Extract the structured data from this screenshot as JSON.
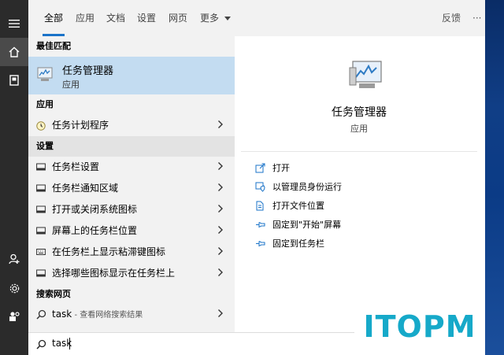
{
  "rail": {
    "icons": [
      "menu-icon",
      "home-icon",
      "document-icon",
      "user-icon",
      "settings-icon",
      "user-settings-icon"
    ]
  },
  "header": {
    "tabs": [
      {
        "label": "全部",
        "active": true
      },
      {
        "label": "应用",
        "active": false
      },
      {
        "label": "文档",
        "active": false
      },
      {
        "label": "设置",
        "active": false
      },
      {
        "label": "网页",
        "active": false
      },
      {
        "label": "更多",
        "active": false
      }
    ],
    "feedback": "反馈",
    "more_dots": "···"
  },
  "results": {
    "best_match_heading": "最佳匹配",
    "best_match": {
      "title": "任务管理器",
      "subtitle": "应用"
    },
    "apps_heading": "应用",
    "apps": [
      {
        "label": "任务计划程序"
      }
    ],
    "settings_heading": "设置",
    "settings": [
      {
        "label": "任务栏设置"
      },
      {
        "label": "任务栏通知区域"
      },
      {
        "label": "打开或关闭系统图标"
      },
      {
        "label": "屏幕上的任务栏位置"
      },
      {
        "label": "在任务栏上显示粘滞键图标"
      },
      {
        "label": "选择哪些图标显示在任务栏上"
      }
    ],
    "web_heading": "搜索网页",
    "web": {
      "query": "task",
      "hint": " - 查看网络搜索结果"
    }
  },
  "detail": {
    "title": "任务管理器",
    "subtitle": "应用",
    "actions": [
      {
        "label": "打开",
        "icon": "open-icon"
      },
      {
        "label": "以管理员身份运行",
        "icon": "admin-shield-icon"
      },
      {
        "label": "打开文件位置",
        "icon": "file-location-icon"
      },
      {
        "label": "固定到\"开始\"屏幕",
        "icon": "pin-icon"
      },
      {
        "label": "固定到任务栏",
        "icon": "pin-icon"
      }
    ]
  },
  "search": {
    "value": "task"
  },
  "watermark": "ITOPM",
  "colors": {
    "accent": "#1a73c8",
    "selected": "#c3dcf1",
    "rail": "#2b2b2b",
    "panel": "#f2f2f2",
    "watermark": "#16a9c9"
  }
}
